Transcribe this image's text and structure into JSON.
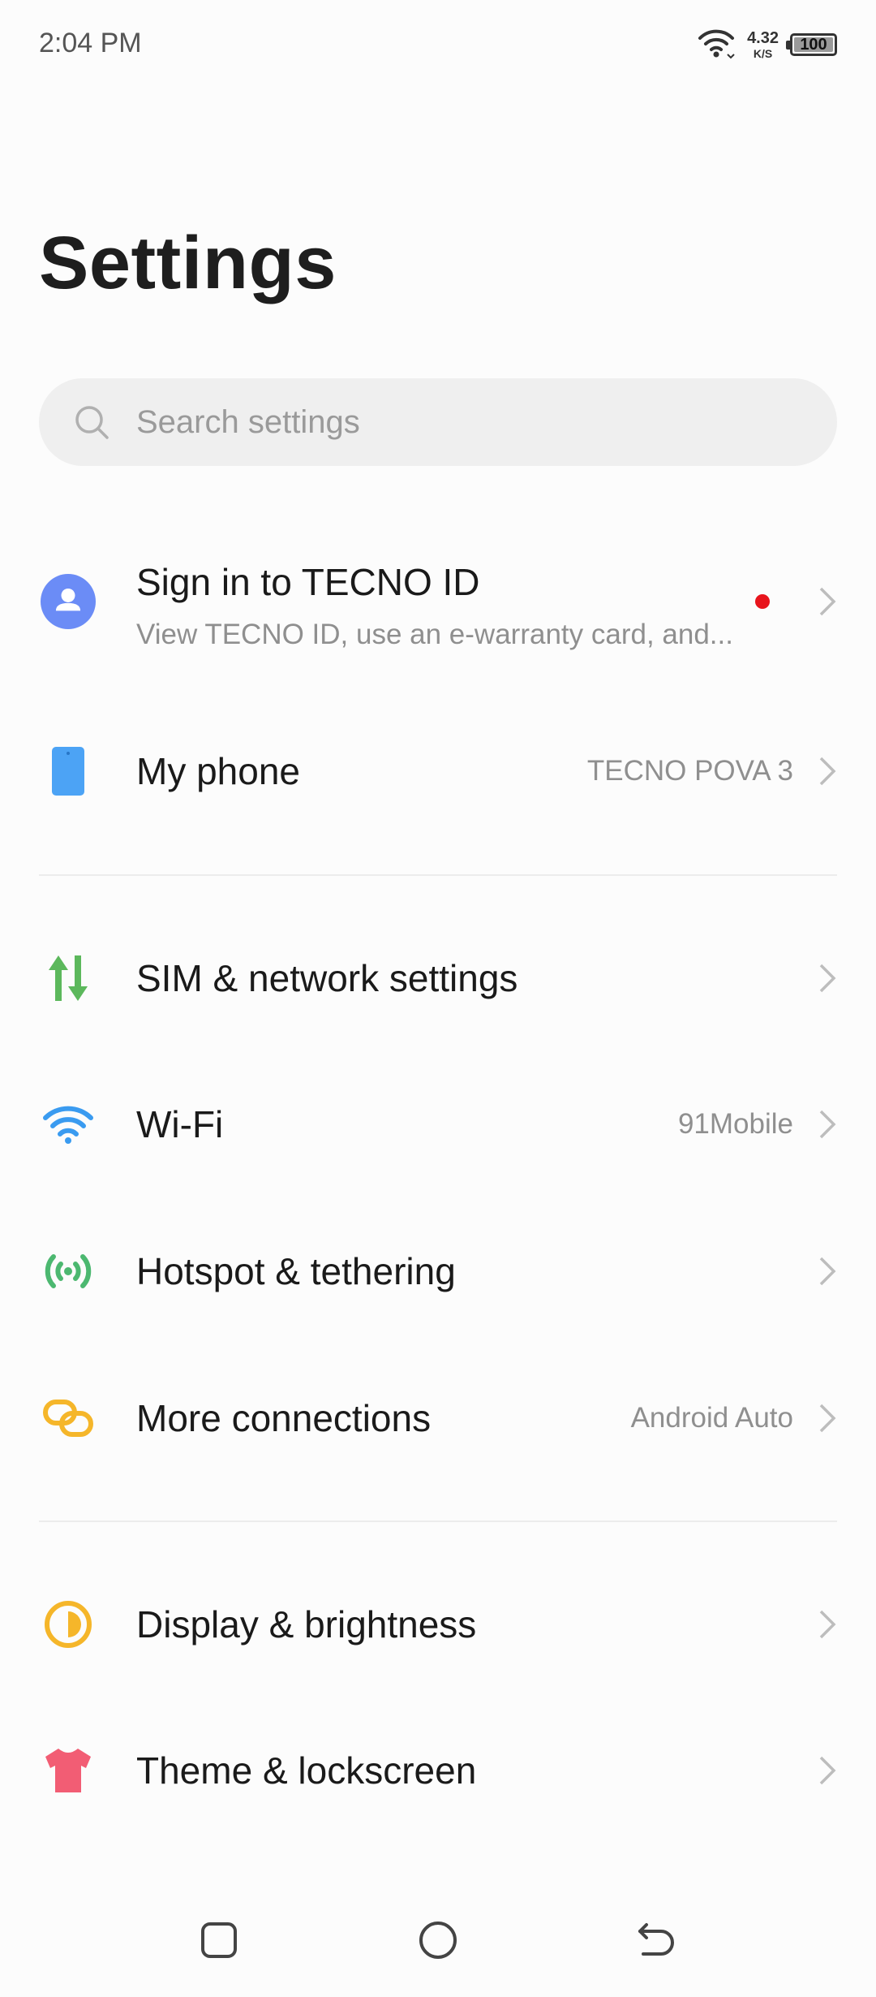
{
  "status_bar": {
    "time": "2:04 PM",
    "net_speed_value": "4.32",
    "net_speed_unit": "K/S",
    "battery_level": "100"
  },
  "header": {
    "title": "Settings"
  },
  "search": {
    "placeholder": "Search settings"
  },
  "account": {
    "label": "Sign in to TECNO ID",
    "subtitle": "View TECNO ID, use an e-warranty card, and..."
  },
  "items": [
    {
      "id": "my-phone",
      "label": "My phone",
      "value": "TECNO POVA 3",
      "icon": "phone-icon",
      "color": "#4ca3f5"
    },
    {
      "id": "sim-network",
      "label": "SIM & network settings",
      "value": "",
      "icon": "sim-network-icon",
      "color": "#5cb85c"
    },
    {
      "id": "wifi",
      "label": "Wi-Fi",
      "value": "91Mobile",
      "icon": "wifi-icon",
      "color": "#3a9bf0"
    },
    {
      "id": "hotspot",
      "label": "Hotspot & tethering",
      "value": "",
      "icon": "hotspot-icon",
      "color": "#4cb870"
    },
    {
      "id": "more-connections",
      "label": "More connections",
      "value": "Android Auto",
      "icon": "link-icon",
      "color": "#f5b62a"
    },
    {
      "id": "display",
      "label": "Display & brightness",
      "value": "",
      "icon": "brightness-icon",
      "color": "#f5b62a"
    },
    {
      "id": "theme",
      "label": "Theme & lockscreen",
      "value": "",
      "icon": "tshirt-icon",
      "color": "#f25d74"
    }
  ],
  "colors": {
    "accent_blue": "#6b8cf6",
    "notification_dot": "#e8141c"
  }
}
